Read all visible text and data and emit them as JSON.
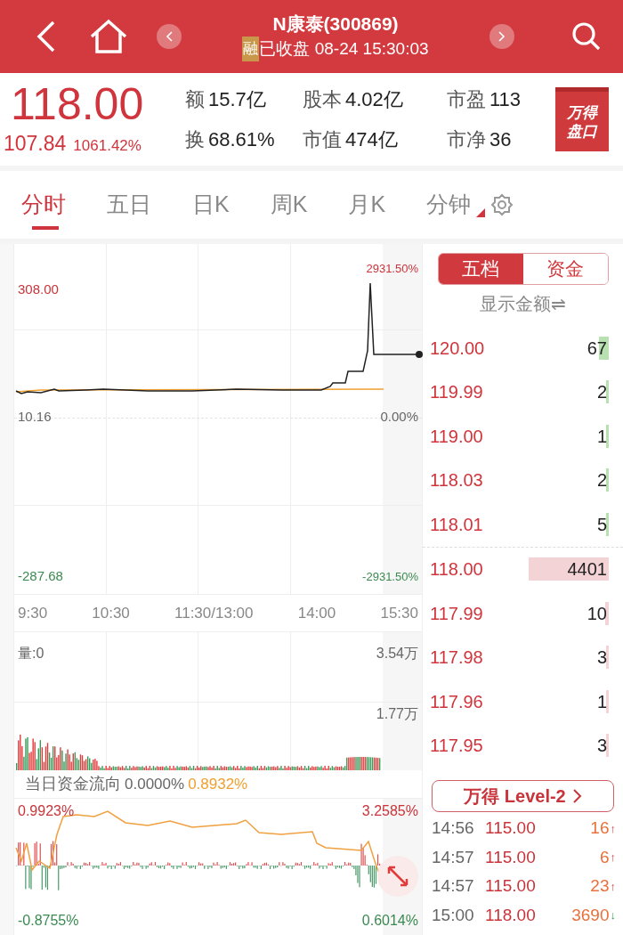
{
  "header": {
    "title": "N康泰(300869)",
    "margin_badge": "融",
    "status": "已收盘 08-24 15:30:03"
  },
  "quote": {
    "price": "118.00",
    "change": "107.84",
    "change_pct": "1061.42%",
    "stats": [
      {
        "label": "额",
        "value": "15.7亿"
      },
      {
        "label": "股本",
        "value": "4.02亿"
      },
      {
        "label": "市盈",
        "value": "113"
      },
      {
        "label": "换",
        "value": "68.61%"
      },
      {
        "label": "市值",
        "value": "474亿"
      },
      {
        "label": "市净",
        "value": "36"
      }
    ],
    "badge_lines": [
      "万得",
      "盘口"
    ]
  },
  "tabs": [
    {
      "label": "分时",
      "selected": true,
      "kind": "plain"
    },
    {
      "label": "五日",
      "selected": false,
      "kind": "plain"
    },
    {
      "label": "日K",
      "selected": false,
      "kind": "plain"
    },
    {
      "label": "周K",
      "selected": false,
      "kind": "plain"
    },
    {
      "label": "月K",
      "selected": false,
      "kind": "plain"
    },
    {
      "label": "分钟",
      "selected": false,
      "kind": "dropdown"
    }
  ],
  "price_chart": {
    "high": "308.00",
    "base": "10.16",
    "low": "-287.68",
    "high_pct": "2931.50%",
    "base_pct": "0.00%",
    "low_pct": "-2931.50%",
    "times": [
      "9:30",
      "10:30",
      "11:30/13:00",
      "14:00",
      "15:30"
    ]
  },
  "volume_chart": {
    "label": "量:0",
    "max": "3.54万",
    "mid": "1.77万"
  },
  "fund_flow": {
    "title": "当日资金流向",
    "value_main": "0.0000%",
    "value_avg": "0.8932%",
    "left_max": "0.9923%",
    "right_max": "3.2585%",
    "left_min": "-0.8755%",
    "right_min": "0.6014%"
  },
  "order_book": {
    "tabs": [
      {
        "label": "五档",
        "selected": true
      },
      {
        "label": "资金",
        "selected": false
      }
    ],
    "toggle": "显示金额⇌",
    "asks": [
      {
        "price": "120.00",
        "volume": "67"
      },
      {
        "price": "119.99",
        "volume": "2"
      },
      {
        "price": "119.00",
        "volume": "1"
      },
      {
        "price": "118.03",
        "volume": "2"
      },
      {
        "price": "118.01",
        "volume": "5"
      }
    ],
    "bids": [
      {
        "price": "118.00",
        "volume": "4401"
      },
      {
        "price": "117.99",
        "volume": "10"
      },
      {
        "price": "117.98",
        "volume": "3"
      },
      {
        "price": "117.96",
        "volume": "1"
      },
      {
        "price": "117.95",
        "volume": "3"
      }
    ]
  },
  "level2_button": "万得 Level-2",
  "trades": [
    {
      "time": "14:56",
      "price": "115.00",
      "volume": "16",
      "arrow": "↑",
      "kind": "buy"
    },
    {
      "time": "14:57",
      "price": "115.00",
      "volume": "6",
      "arrow": "↑",
      "kind": "buy"
    },
    {
      "time": "14:57",
      "price": "115.00",
      "volume": "23",
      "arrow": "↑",
      "kind": "buy"
    },
    {
      "time": "15:00",
      "price": "118.00",
      "volume": "3690",
      "arrow": "↓",
      "kind": "sell"
    }
  ]
}
